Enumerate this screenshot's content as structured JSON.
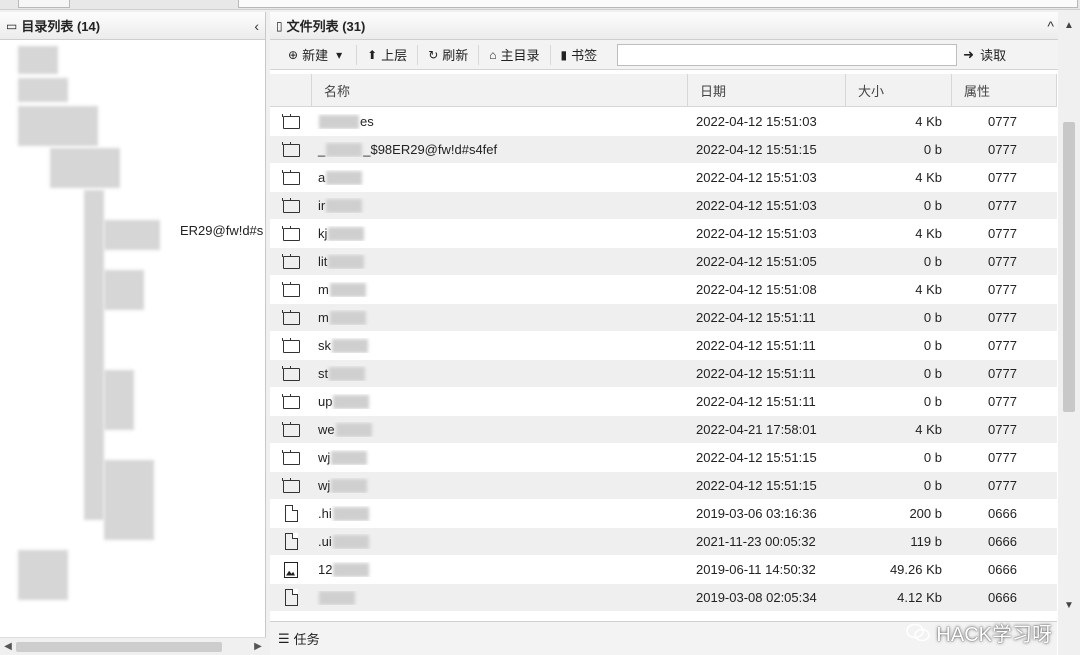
{
  "left_panel": {
    "title": "目录列表 (14)",
    "collapse_glyph": "‹",
    "visible_node_text": "ER29@fw!d#s"
  },
  "right_panel": {
    "title": "文件列表 (31)",
    "collapse_glyph": "^"
  },
  "toolbar": {
    "new_label": "新建",
    "up_label": "上层",
    "refresh_label": "刷新",
    "home_label": "主目录",
    "bookmark_label": "书签",
    "read_label": "读取",
    "path_value": ""
  },
  "table": {
    "headers": {
      "name": "名称",
      "date": "日期",
      "size": "大小",
      "attr": "属性"
    },
    "rows": [
      {
        "icon": "folder",
        "prefix": "",
        "suffix": "es",
        "date": "2022-04-12 15:51:03",
        "size": "4 Kb",
        "attr": "0777"
      },
      {
        "icon": "folder",
        "prefix": "_",
        "suffix": "_$98ER29@fw!d#s4fef",
        "date": "2022-04-12 15:51:15",
        "size": "0 b",
        "attr": "0777"
      },
      {
        "icon": "folder",
        "prefix": "a",
        "suffix": "",
        "date": "2022-04-12 15:51:03",
        "size": "4 Kb",
        "attr": "0777"
      },
      {
        "icon": "folder",
        "prefix": "ir",
        "suffix": "",
        "date": "2022-04-12 15:51:03",
        "size": "0 b",
        "attr": "0777"
      },
      {
        "icon": "folder",
        "prefix": "kj",
        "suffix": "",
        "date": "2022-04-12 15:51:03",
        "size": "4 Kb",
        "attr": "0777"
      },
      {
        "icon": "folder",
        "prefix": "lit",
        "suffix": "",
        "date": "2022-04-12 15:51:05",
        "size": "0 b",
        "attr": "0777"
      },
      {
        "icon": "folder",
        "prefix": "m",
        "suffix": "",
        "date": "2022-04-12 15:51:08",
        "size": "4 Kb",
        "attr": "0777"
      },
      {
        "icon": "folder",
        "prefix": "m",
        "suffix": "",
        "date": "2022-04-12 15:51:11",
        "size": "0 b",
        "attr": "0777"
      },
      {
        "icon": "folder",
        "prefix": "sk",
        "suffix": "",
        "date": "2022-04-12 15:51:11",
        "size": "0 b",
        "attr": "0777"
      },
      {
        "icon": "folder",
        "prefix": "st",
        "suffix": "",
        "date": "2022-04-12 15:51:11",
        "size": "0 b",
        "attr": "0777"
      },
      {
        "icon": "folder",
        "prefix": "up",
        "suffix": "",
        "date": "2022-04-12 15:51:11",
        "size": "0 b",
        "attr": "0777"
      },
      {
        "icon": "folder",
        "prefix": "we",
        "suffix": "",
        "date": "2022-04-21 17:58:01",
        "size": "4 Kb",
        "attr": "0777"
      },
      {
        "icon": "folder",
        "prefix": "wj",
        "suffix": "",
        "date": "2022-04-12 15:51:15",
        "size": "0 b",
        "attr": "0777"
      },
      {
        "icon": "folder",
        "prefix": "wj",
        "suffix": "",
        "date": "2022-04-12 15:51:15",
        "size": "0 b",
        "attr": "0777"
      },
      {
        "icon": "file",
        "prefix": ".hi",
        "suffix": "",
        "date": "2019-03-06 03:16:36",
        "size": "200 b",
        "attr": "0666"
      },
      {
        "icon": "file",
        "prefix": ".ui",
        "suffix": "",
        "date": "2021-11-23 00:05:32",
        "size": "119 b",
        "attr": "0666"
      },
      {
        "icon": "image",
        "prefix": "12",
        "suffix": "",
        "date": "2019-06-11 14:50:32",
        "size": "49.26 Kb",
        "attr": "0666"
      },
      {
        "icon": "file",
        "prefix": "",
        "suffix": "",
        "date": "2019-03-08 02:05:34",
        "size": "4.12 Kb",
        "attr": "0666"
      }
    ]
  },
  "taskbar": {
    "label": "任务"
  },
  "watermark": {
    "text": "HACK学习呀"
  }
}
